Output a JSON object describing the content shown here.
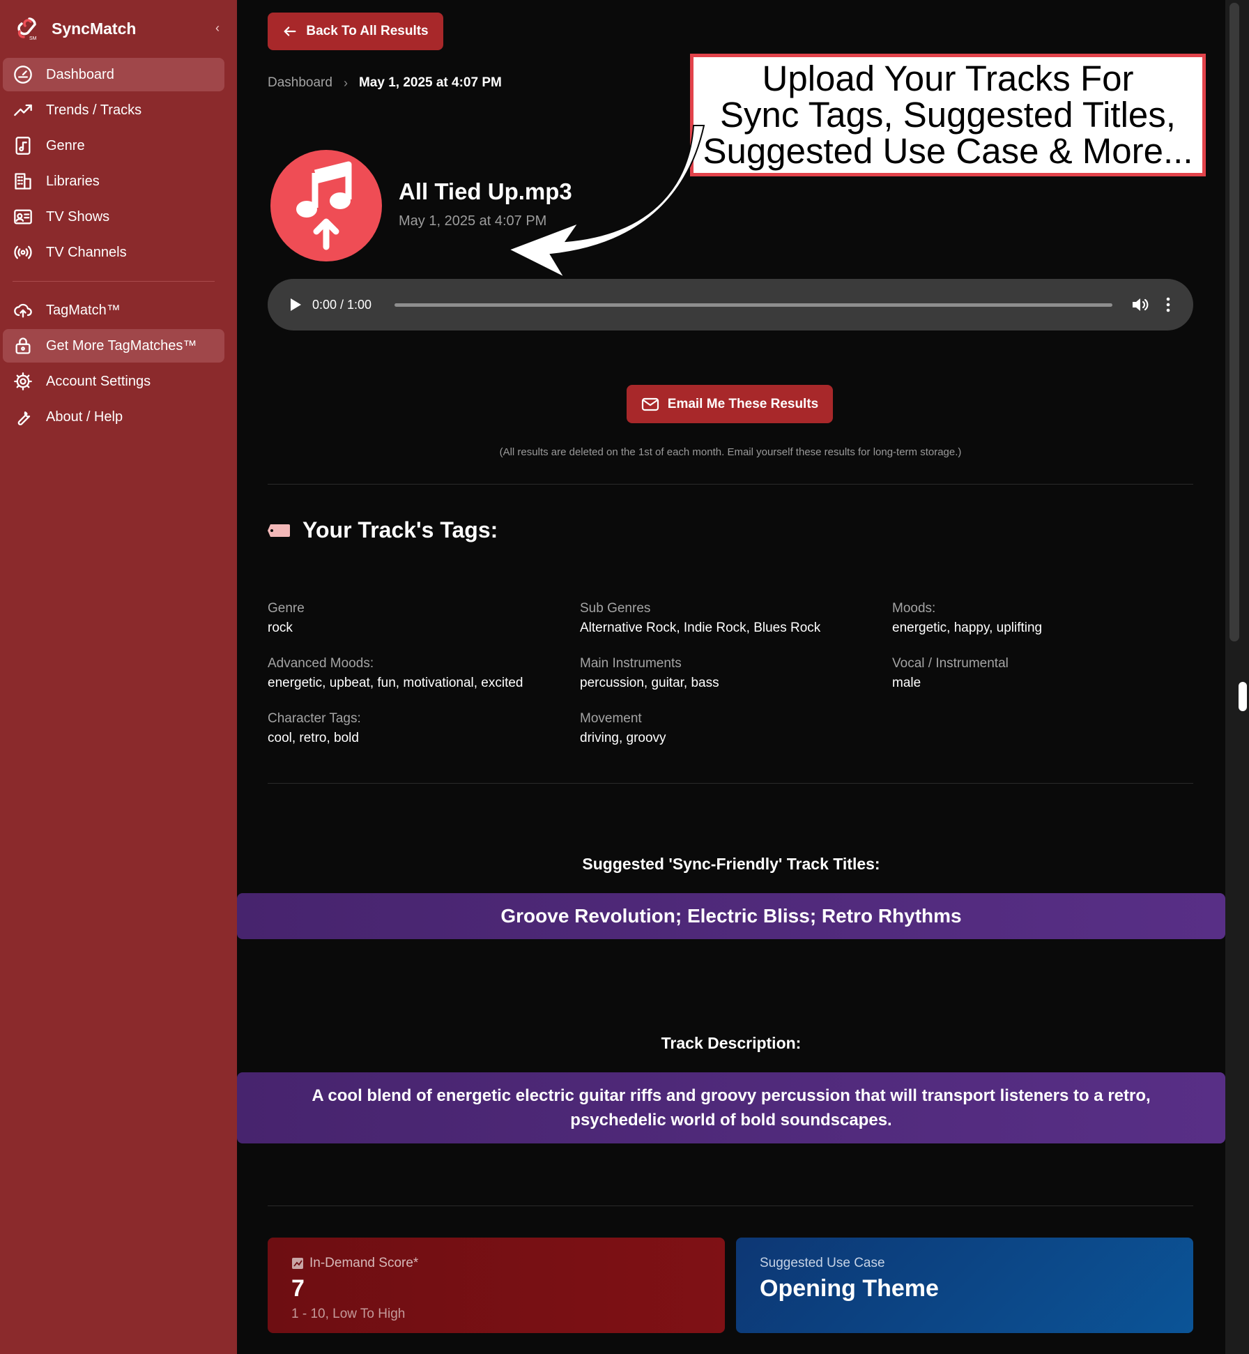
{
  "app": {
    "name": "SyncMatch",
    "collapse_glyph": "‹"
  },
  "sidebar": {
    "items": [
      {
        "label": "Dashboard",
        "icon": "dashboard-gauge-icon"
      },
      {
        "label": "Trends / Tracks",
        "icon": "trending-up-icon"
      },
      {
        "label": "Genre",
        "icon": "music-file-icon"
      },
      {
        "label": "Libraries",
        "icon": "building-icon"
      },
      {
        "label": "TV Shows",
        "icon": "id-card-icon"
      },
      {
        "label": "TV Channels",
        "icon": "broadcast-icon"
      },
      {
        "label": "TagMatch™",
        "icon": "cloud-upload-icon"
      },
      {
        "label": "Get More TagMatches™",
        "icon": "lock-icon"
      },
      {
        "label": "Account Settings",
        "icon": "gear-icon"
      },
      {
        "label": "About / Help",
        "icon": "wrench-icon"
      }
    ]
  },
  "header": {
    "back_label": "Back To All Results",
    "breadcrumb_root": "Dashboard",
    "breadcrumb_current": "May 1, 2025 at 4:07 PM"
  },
  "track": {
    "title": "All Tied Up.mp3",
    "date": "May 1, 2025 at 4:07 PM"
  },
  "player": {
    "time": "0:00 / 1:00",
    "progress": 0
  },
  "email": {
    "button_label": "Email Me These Results",
    "note": "(All results are deleted on the 1st of each month. Email yourself these results for long-term storage.)"
  },
  "tags": {
    "heading": "Your Track's Tags:",
    "items": [
      {
        "label": "Genre",
        "value": "rock"
      },
      {
        "label": "Sub Genres",
        "value": "Alternative Rock, Indie Rock, Blues Rock"
      },
      {
        "label": "Moods:",
        "value": "energetic, happy, uplifting"
      },
      {
        "label": "Advanced Moods:",
        "value": "energetic, upbeat, fun, motivational, excited"
      },
      {
        "label": "Main Instruments",
        "value": "percussion, guitar, bass"
      },
      {
        "label": "Vocal / Instrumental",
        "value": "male"
      },
      {
        "label": "Character Tags:",
        "value": "cool, retro, bold"
      },
      {
        "label": "Movement",
        "value": "driving, groovy"
      }
    ]
  },
  "titles": {
    "heading": "Suggested 'Sync-Friendly' Track Titles:",
    "value": "Groove Revolution; Electric Bliss; Retro Rhythms"
  },
  "description": {
    "heading": "Track Description:",
    "value": "A cool blend of energetic electric guitar riffs and groovy percussion that will transport listeners to a retro, psychedelic world of bold soundscapes."
  },
  "score": {
    "label": "In-Demand Score*",
    "value": "7",
    "scale": "1 - 10, Low To High"
  },
  "use_case": {
    "label": "Suggested Use Case",
    "value": "Opening Theme"
  },
  "callout": {
    "line1": "Upload Your Tracks For",
    "line2": "Sync Tags, Suggested Titles,",
    "line3": "Suggested Use Case & More..."
  },
  "colors": {
    "sidebar": "#8b2a2c",
    "accent_button": "#a8282a",
    "track_icon": "#ef4d55",
    "purple_bar": "#502a7a",
    "score_card": "#7a1014",
    "use_case_card": "#0b4a8a",
    "callout_border": "#e2434b"
  }
}
